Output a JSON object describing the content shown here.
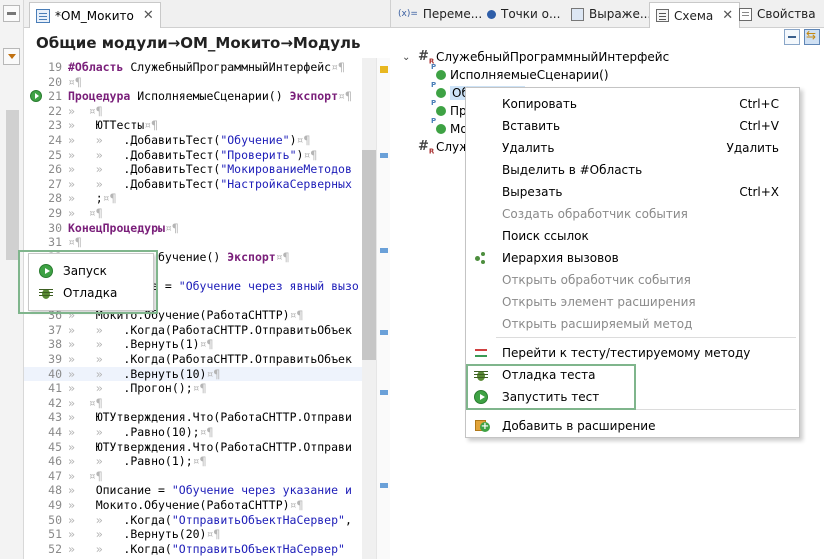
{
  "editor": {
    "tab_title": "*ОМ_Мокито",
    "tab_close": "✕",
    "breadcrumb": "Общие модули→ОМ_Мокито→Модуль",
    "lines": [
      {
        "n": "19",
        "text": [
          [
            "kw",
            "#Область"
          ],
          [
            "plain",
            " СлужебныйПрограммныйИнтерфейс"
          ],
          [
            "ws",
            "¤¶"
          ]
        ]
      },
      {
        "n": "20",
        "text": [
          [
            "ws",
            "¤¶"
          ]
        ]
      },
      {
        "n": "21",
        "text": [
          [
            "kw",
            "Процедура"
          ],
          [
            "plain",
            " ИсполняемыеСценарии() "
          ],
          [
            "kw",
            "Экспорт"
          ],
          [
            "ws",
            "¤¶"
          ]
        ],
        "marker": true
      },
      {
        "n": "22",
        "text": [
          [
            "ws",
            "»  ¤¶"
          ]
        ]
      },
      {
        "n": "23",
        "text": [
          [
            "ws",
            "»   "
          ],
          [
            "plain",
            "ЮТТесты"
          ],
          [
            "ws",
            "¤¶"
          ]
        ]
      },
      {
        "n": "24",
        "text": [
          [
            "ws",
            "»   »   "
          ],
          [
            "plain",
            ".ДобавитьТест("
          ],
          [
            "str",
            "\"Обучение\""
          ],
          [
            "plain",
            ")"
          ],
          [
            "ws",
            "¤¶"
          ]
        ]
      },
      {
        "n": "25",
        "text": [
          [
            "ws",
            "»   »   "
          ],
          [
            "plain",
            ".ДобавитьТест("
          ],
          [
            "str",
            "\"Проверить\""
          ],
          [
            "plain",
            ")"
          ],
          [
            "ws",
            "¤¶"
          ]
        ]
      },
      {
        "n": "26",
        "text": [
          [
            "ws",
            "»   »   "
          ],
          [
            "plain",
            ".ДобавитьТест("
          ],
          [
            "str",
            "\"МокированиеМетодов"
          ]
        ]
      },
      {
        "n": "27",
        "text": [
          [
            "ws",
            "»   »   "
          ],
          [
            "plain",
            ".ДобавитьТест("
          ],
          [
            "str",
            "\"НастройкаСерверных"
          ]
        ]
      },
      {
        "n": "28",
        "text": [
          [
            "ws",
            "»   "
          ],
          [
            "plain",
            ";"
          ],
          [
            "ws",
            "¤¶"
          ]
        ]
      },
      {
        "n": "29",
        "text": [
          [
            "ws",
            "»  ¤¶"
          ]
        ]
      },
      {
        "n": "30",
        "text": [
          [
            "kw",
            "КонецПроцедуры"
          ],
          [
            "ws",
            "¤¶"
          ]
        ]
      },
      {
        "n": "31",
        "text": [
          [
            "ws",
            "¤¶"
          ]
        ]
      },
      {
        "n": "32",
        "text": [
          [
            "plain",
            "             бучение() "
          ],
          [
            "kw",
            "Экспорт"
          ],
          [
            "ws",
            "¤¶"
          ]
        ]
      },
      {
        "n": "33",
        "text": [
          [
            "ws",
            "  ¤¶"
          ]
        ]
      },
      {
        "n": "34",
        "text": [
          [
            "plain",
            "            е = "
          ],
          [
            "str",
            "\"Обучение через явный вызо"
          ]
        ]
      },
      {
        "n": "35",
        "text": [
          [
            "ws",
            "  ¤¶"
          ]
        ]
      },
      {
        "n": "36",
        "text": [
          [
            "ws",
            "»   "
          ],
          [
            "plain",
            "Мокито.Обучение(РаботаСHTTP)"
          ],
          [
            "ws",
            "¤¶"
          ]
        ]
      },
      {
        "n": "37",
        "text": [
          [
            "ws",
            "»   »   "
          ],
          [
            "plain",
            ".Когда(РаботаСHTTP.ОтправитьОбъек"
          ]
        ]
      },
      {
        "n": "38",
        "text": [
          [
            "ws",
            "»   »   "
          ],
          [
            "plain",
            ".Вернуть(1)"
          ],
          [
            "ws",
            "¤¶"
          ]
        ]
      },
      {
        "n": "39",
        "text": [
          [
            "ws",
            "»   »   "
          ],
          [
            "plain",
            ".Когда(РаботаСHTTP.ОтправитьОбъек"
          ]
        ]
      },
      {
        "n": "40",
        "text": [
          [
            "ws",
            "»   »   "
          ],
          [
            "plain",
            ".Вернуть(10)"
          ],
          [
            "ws",
            "¤¶"
          ]
        ],
        "highlight": true
      },
      {
        "n": "41",
        "text": [
          [
            "ws",
            "»   »   "
          ],
          [
            "plain",
            ".Прогон();"
          ],
          [
            "ws",
            "¤¶"
          ]
        ]
      },
      {
        "n": "42",
        "text": [
          [
            "ws",
            "»  ¤¶"
          ]
        ]
      },
      {
        "n": "43",
        "text": [
          [
            "ws",
            "»   "
          ],
          [
            "plain",
            "ЮТУтверждения.Что(РаботаСHTTP.Отправи"
          ]
        ]
      },
      {
        "n": "44",
        "text": [
          [
            "ws",
            "»   »   "
          ],
          [
            "plain",
            ".Равно(10);"
          ],
          [
            "ws",
            "¤¶"
          ]
        ]
      },
      {
        "n": "45",
        "text": [
          [
            "ws",
            "»   "
          ],
          [
            "plain",
            "ЮТУтверждения.Что(РаботаСHTTP.Отправи"
          ]
        ]
      },
      {
        "n": "46",
        "text": [
          [
            "ws",
            "»   »   "
          ],
          [
            "plain",
            ".Равно(1);"
          ],
          [
            "ws",
            "¤¶"
          ]
        ]
      },
      {
        "n": "47",
        "text": [
          [
            "ws",
            "»  ¤¶"
          ]
        ]
      },
      {
        "n": "48",
        "text": [
          [
            "ws",
            "»   "
          ],
          [
            "plain",
            "Описание = "
          ],
          [
            "str",
            "\"Обучение через указание и"
          ]
        ]
      },
      {
        "n": "49",
        "text": [
          [
            "ws",
            "»   "
          ],
          [
            "plain",
            "Мокито.Обучение(РаботаСHTTP)"
          ],
          [
            "ws",
            "¤¶"
          ]
        ]
      },
      {
        "n": "50",
        "text": [
          [
            "ws",
            "»   »   "
          ],
          [
            "plain",
            ".Когда("
          ],
          [
            "str",
            "\"ОтправитьОбъектНаСервер\""
          ],
          [
            "plain",
            ","
          ]
        ]
      },
      {
        "n": "51",
        "text": [
          [
            "ws",
            "»   »   "
          ],
          [
            "plain",
            ".Вернуть(20)"
          ],
          [
            "ws",
            "¤¶"
          ]
        ]
      },
      {
        "n": "52",
        "text": [
          [
            "ws",
            "»   »   "
          ],
          [
            "plain",
            ".Когда("
          ],
          [
            "str",
            "\"ОтправитьОбъектНаСервер\""
          ]
        ]
      }
    ]
  },
  "small_popup": {
    "items": [
      {
        "label": "Запуск",
        "icon": "play-icon"
      },
      {
        "label": "Отладка",
        "icon": "bug-icon"
      }
    ]
  },
  "right_tabs": [
    {
      "label": "Переме...",
      "icon": "variables-icon",
      "prefix": "(x)="
    },
    {
      "label": "Точки о...",
      "icon": "breakpoints-icon"
    },
    {
      "label": "Выраже...",
      "icon": "expressions-icon"
    },
    {
      "label": "Схема",
      "icon": "outline-icon",
      "active": true
    },
    {
      "label": "Свойства",
      "icon": "properties-icon"
    }
  ],
  "outline_tab_close": "✕",
  "tree": {
    "root_label": "СлужебныйПрограммныйИнтерфейс",
    "items": [
      "ИсполняемыеСценарии()",
      "Обучение()",
      "Пр",
      "Мо"
    ],
    "second_root": "Служ"
  },
  "context_menu": {
    "items": [
      {
        "label": "Копировать",
        "shortcut": "Ctrl+C",
        "disabled": false
      },
      {
        "label": "Вставить",
        "shortcut": "Ctrl+V",
        "disabled": false
      },
      {
        "label": "Удалить",
        "shortcut": "Удалить",
        "disabled": false
      },
      {
        "label": "Выделить в #Область",
        "shortcut": "",
        "disabled": false
      },
      {
        "label": "Вырезать",
        "shortcut": "Ctrl+X",
        "disabled": false
      },
      {
        "label": "Создать обработчик события",
        "shortcut": "",
        "disabled": true
      },
      {
        "label": "Поиск ссылок",
        "shortcut": "",
        "disabled": false
      },
      {
        "label": "Иерархия вызовов",
        "shortcut": "",
        "disabled": false,
        "icon": "hierarchy-icon"
      },
      {
        "label": "Открыть обработчик события",
        "shortcut": "",
        "disabled": true
      },
      {
        "label": "Открыть элемент расширения",
        "shortcut": "",
        "disabled": true
      },
      {
        "label": "Открыть расширяемый метод",
        "shortcut": "",
        "disabled": true
      },
      {
        "label": "Перейти к тесту/тестируемому методу",
        "shortcut": "",
        "disabled": false,
        "icon": "goto-test-icon"
      },
      {
        "label": "Отладка теста",
        "shortcut": "",
        "disabled": false,
        "icon": "bug-icon"
      },
      {
        "label": "Запустить тест",
        "shortcut": "",
        "disabled": false,
        "icon": "play-icon"
      },
      {
        "label": "Добавить в расширение",
        "shortcut": "",
        "disabled": false,
        "icon": "add-extension-icon"
      }
    ]
  },
  "colors": {
    "keyword": "#7a1f7a",
    "string": "#1c1cb8",
    "frame_green": "#7fb58c",
    "selection": "#cde3f8"
  }
}
